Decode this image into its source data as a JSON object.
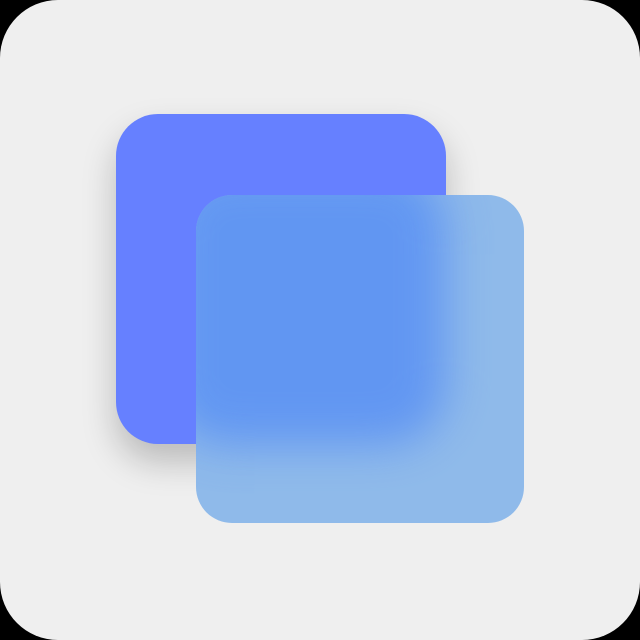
{
  "icon": {
    "name": "layers-icon",
    "colors": {
      "background": "#efefef",
      "back_square": "#6680ff",
      "front_glass": "#8fbaea",
      "overlap_tint": "#5d93f3"
    }
  }
}
